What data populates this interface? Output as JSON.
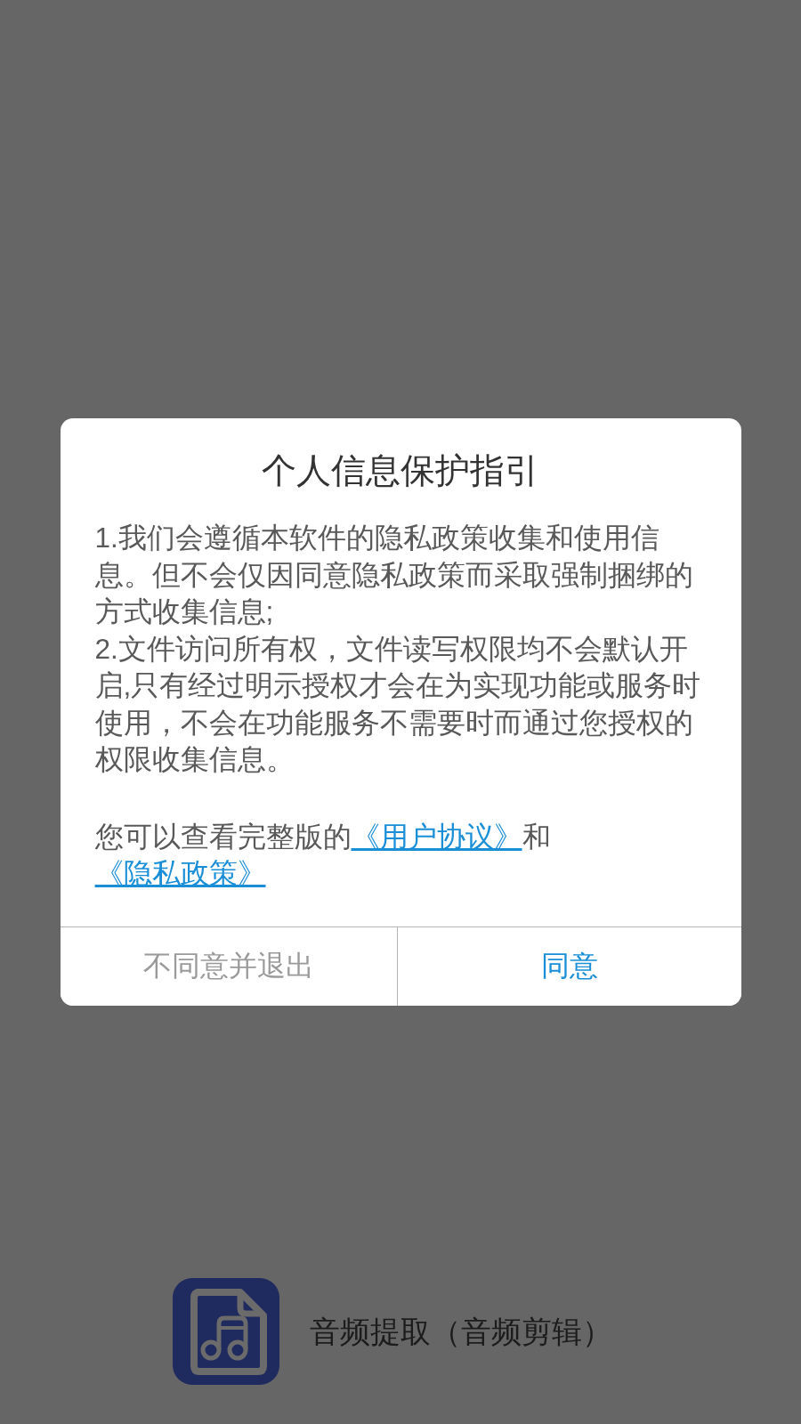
{
  "dialog": {
    "title": "个人信息保护指引",
    "paragraphs": [
      "1.我们会遵循本软件的隐私政策收集和使用信息。但不会仅因同意隐私政策而采取强制捆绑的方式收集信息;",
      "2.文件访问所有权，文件读写权限均不会默认开启,只有经过明示授权才会在为实现功能或服务时使用，不会在功能服务不需要时而通过您授权的权限收集信息。"
    ],
    "notice": [
      {
        "kind": "text",
        "text": "您可以查看完整版的"
      },
      {
        "kind": "link",
        "text": "《用户协议》"
      },
      {
        "kind": "text",
        "text": "和"
      },
      {
        "kind": "link",
        "text": "《隐私政策》"
      }
    ],
    "buttons": [
      {
        "kind": "secondary",
        "label": "不同意并退出"
      },
      {
        "kind": "primary",
        "label": "同意"
      }
    ]
  },
  "splash": {
    "app_name": "音频提取（音频剪辑）"
  }
}
